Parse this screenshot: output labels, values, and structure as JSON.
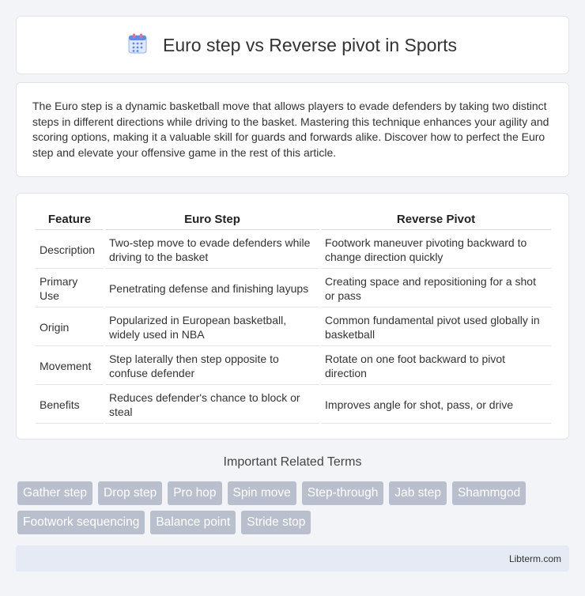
{
  "header": {
    "title": "Euro step vs Reverse pivot in Sports",
    "icon": "calendar-icon"
  },
  "intro": {
    "text": "The Euro step is a dynamic basketball move that allows players to evade defenders by taking two distinct steps in different directions while driving to the basket. Mastering this technique enhances your agility and scoring options, making it a valuable skill for guards and forwards alike. Discover how to perfect the Euro step and elevate your offensive game in the rest of this article."
  },
  "table": {
    "headers": [
      "Feature",
      "Euro Step",
      "Reverse Pivot"
    ],
    "rows": [
      [
        "Description",
        "Two-step move to evade defenders while driving to the basket",
        "Footwork maneuver pivoting backward to change direction quickly"
      ],
      [
        "Primary Use",
        "Penetrating defense and finishing layups",
        "Creating space and repositioning for a shot or pass"
      ],
      [
        "Origin",
        "Popularized in European basketball, widely used in NBA",
        "Common fundamental pivot used globally in basketball"
      ],
      [
        "Movement",
        "Step laterally then step opposite to confuse defender",
        "Rotate on one foot backward to pivot direction"
      ],
      [
        "Benefits",
        "Reduces defender's chance to block or steal",
        "Improves angle for shot, pass, or drive"
      ]
    ]
  },
  "related": {
    "title": "Important Related Terms",
    "terms": [
      "Gather step",
      "Drop step",
      "Pro hop",
      "Spin move",
      "Step-through",
      "Jab step",
      "Shammgod",
      "Footwork sequencing",
      "Balance point",
      "Stride stop"
    ]
  },
  "footer": {
    "site": "Libterm.com"
  },
  "colors": {
    "background": "#f3f4f8",
    "tag": "#b9bfcc",
    "footer": "#e6eaf4",
    "icon_blue": "#5b8def",
    "icon_pink": "#f06a8c"
  }
}
